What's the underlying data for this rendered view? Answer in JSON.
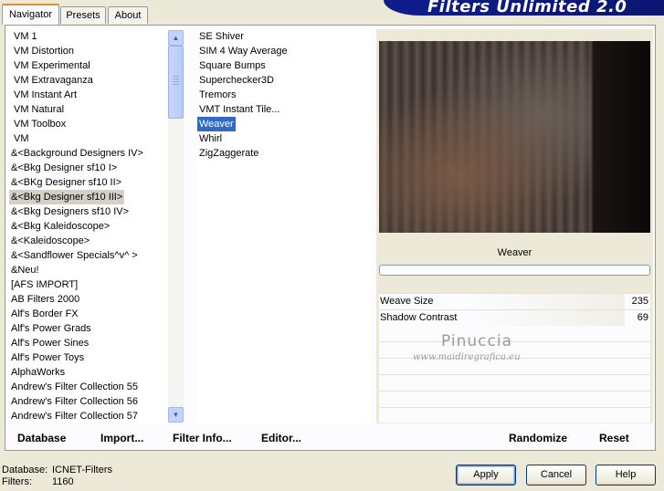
{
  "tabs": [
    "Navigator",
    "Presets",
    "About"
  ],
  "banner_title": "Filters Unlimited 2.0",
  "categories": [
    "VM 1",
    "VM Distortion",
    "VM Experimental",
    "VM Extravaganza",
    "VM Instant Art",
    "VM Natural",
    "VM Toolbox",
    "VM",
    "&<Background Designers IV>",
    "&<Bkg Designer sf10 I>",
    "&<BKg Designer sf10 II>",
    "&<Bkg Designer sf10 III>",
    "&<Bkg Designers sf10 IV>",
    "&<Bkg Kaleidoscope>",
    "&<Kaleidoscope>",
    "&<Sandflower Specials^v^ >",
    "&Neu!",
    "[AFS IMPORT]",
    "AB Filters 2000",
    "Alf's Border FX",
    "Alf's Power Grads",
    "Alf's Power Sines",
    "Alf's Power Toys",
    "AlphaWorks",
    "Andrew's Filter Collection 55",
    "Andrew's Filter Collection 56",
    "Andrew's Filter Collection 57"
  ],
  "selected_category": "&<Bkg Designer sf10 III>",
  "filters": [
    "SE Shiver",
    "SIM 4 Way Average",
    "Square Bumps",
    "Superchecker3D",
    "Tremors",
    "VMT Instant Tile...",
    "Weaver",
    "Whirl",
    "ZigZaggerate"
  ],
  "selected_filter": "Weaver",
  "toolbar": {
    "database": "Database",
    "import": "Import...",
    "filter_info": "Filter Info...",
    "editor": "Editor...",
    "randomize": "Randomize",
    "reset": "Reset"
  },
  "filter_name": "Weaver",
  "params": [
    {
      "label": "Weave Size",
      "value": "235",
      "level": 0.92
    },
    {
      "label": "Shadow Contrast",
      "value": "69",
      "level": 0.27
    }
  ],
  "watermark": {
    "title": "Pinuccia",
    "url": "www.maidiregrafica.eu"
  },
  "status": {
    "database_label": "Database:",
    "database_value": "ICNET-Filters",
    "filters_label": "Filters:",
    "filters_value": "1160"
  },
  "buttons": {
    "apply": "Apply",
    "cancel": "Cancel",
    "help": "Help"
  }
}
